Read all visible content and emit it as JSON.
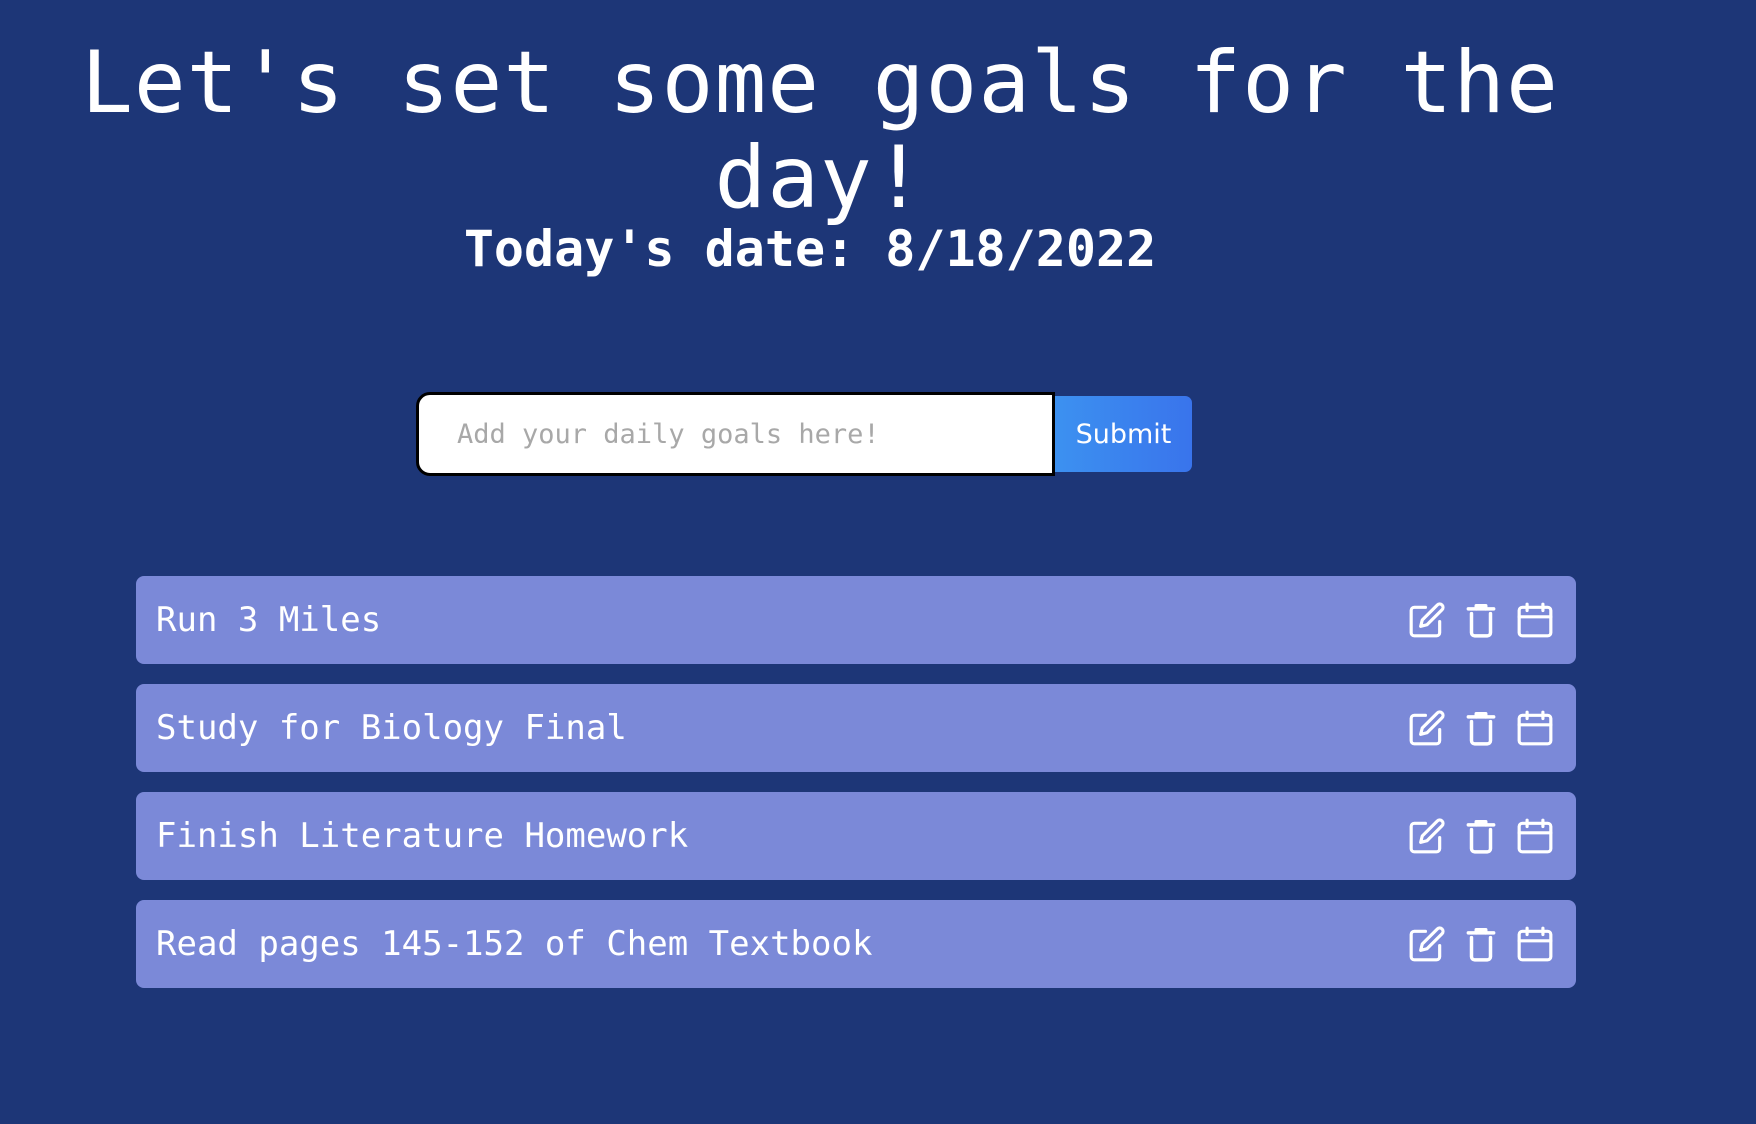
{
  "header": {
    "title": "Let's set some goals for the day!",
    "date_label": "Today's date: 8/18/2022"
  },
  "form": {
    "input_placeholder": "Add your daily goals here!",
    "input_value": "",
    "submit_label": "Submit"
  },
  "goals": [
    {
      "text": "Run 3 Miles",
      "icons": [
        "edit-icon",
        "trash-icon",
        "calendar-icon"
      ]
    },
    {
      "text": "Study for Biology Final",
      "icons": [
        "edit-icon",
        "trash-icon",
        "calendar-icon"
      ]
    },
    {
      "text": "Finish Literature Homework",
      "icons": [
        "edit-icon",
        "trash-icon",
        "calendar-icon"
      ]
    },
    {
      "text": "Read pages 145-152 of Chem Textbook",
      "icons": [
        "edit-icon",
        "trash-icon",
        "calendar-icon"
      ]
    }
  ],
  "colors": {
    "background": "#1d3677",
    "goal_item": "#7b89d8",
    "submit_button": "#3c91f0",
    "text": "#ffffff"
  }
}
